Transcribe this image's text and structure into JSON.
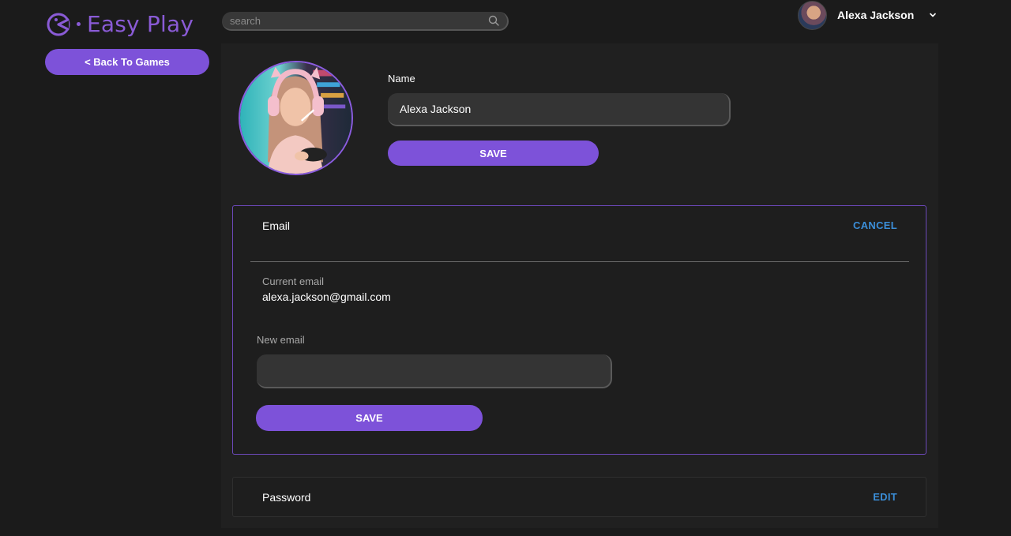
{
  "app": {
    "brand": "Easy Play",
    "accent_color": "#7d52d9",
    "link_color": "#3b8ed8"
  },
  "nav": {
    "back_label": "< Back To Games"
  },
  "search": {
    "placeholder": "search",
    "icon": "search-icon"
  },
  "user": {
    "name": "Alexa Jackson",
    "menu_icon": "chevron-down-icon"
  },
  "profile": {
    "name_label": "Name",
    "name_value": "Alexa Jackson",
    "save_label": "SAVE"
  },
  "email": {
    "title": "Email",
    "cancel_label": "CANCEL",
    "current_label": "Current email",
    "current_value": "alexa.jackson@gmail.com",
    "new_label": "New email",
    "new_value": "",
    "save_label": "SAVE"
  },
  "password": {
    "title": "Password",
    "edit_label": "EDIT"
  }
}
